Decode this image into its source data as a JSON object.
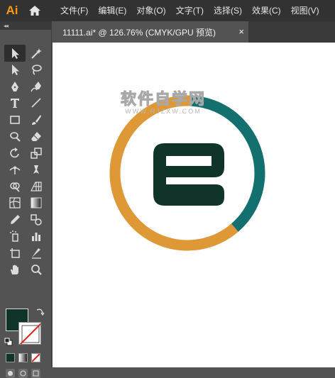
{
  "app": {
    "logo": "Ai"
  },
  "menu": [
    "文件(F)",
    "编辑(E)",
    "对象(O)",
    "文字(T)",
    "选择(S)",
    "效果(C)",
    "视图(V)"
  ],
  "document": {
    "tab_title": "11111.ai* @ 126.76% (CMYK/GPU 预览)",
    "close_glyph": "×"
  },
  "watermark": {
    "main": "软件自学网",
    "sub": "WWW.RJZXW.COM"
  },
  "toolbar": {
    "collapse_glyph": "◂◂",
    "tools": [
      "selection-tool",
      "magic-wand-tool",
      "direct-selection-tool",
      "lasso-tool",
      "pen-tool",
      "curvature-tool",
      "type-tool",
      "line-segment-tool",
      "rectangle-tool",
      "paintbrush-tool",
      "shaper-tool",
      "eraser-tool",
      "rotate-tool",
      "scale-tool",
      "width-tool",
      "puppet-warp-tool",
      "shape-builder-tool",
      "perspective-grid-tool",
      "mesh-tool",
      "gradient-tool",
      "eyedropper-tool",
      "blend-tool",
      "symbol-sprayer-tool",
      "column-graph-tool",
      "artboard-tool",
      "slice-tool",
      "hand-tool",
      "zoom-tool"
    ]
  },
  "colors": {
    "fill": "#11342a",
    "stroke": "none",
    "logo_orange": "#de9836",
    "logo_teal": "#13706e",
    "logo_letter": "#11342a",
    "accent": "#ff9a00"
  },
  "artwork": {
    "orange_share": 0.62,
    "teal_share": 0.38
  }
}
